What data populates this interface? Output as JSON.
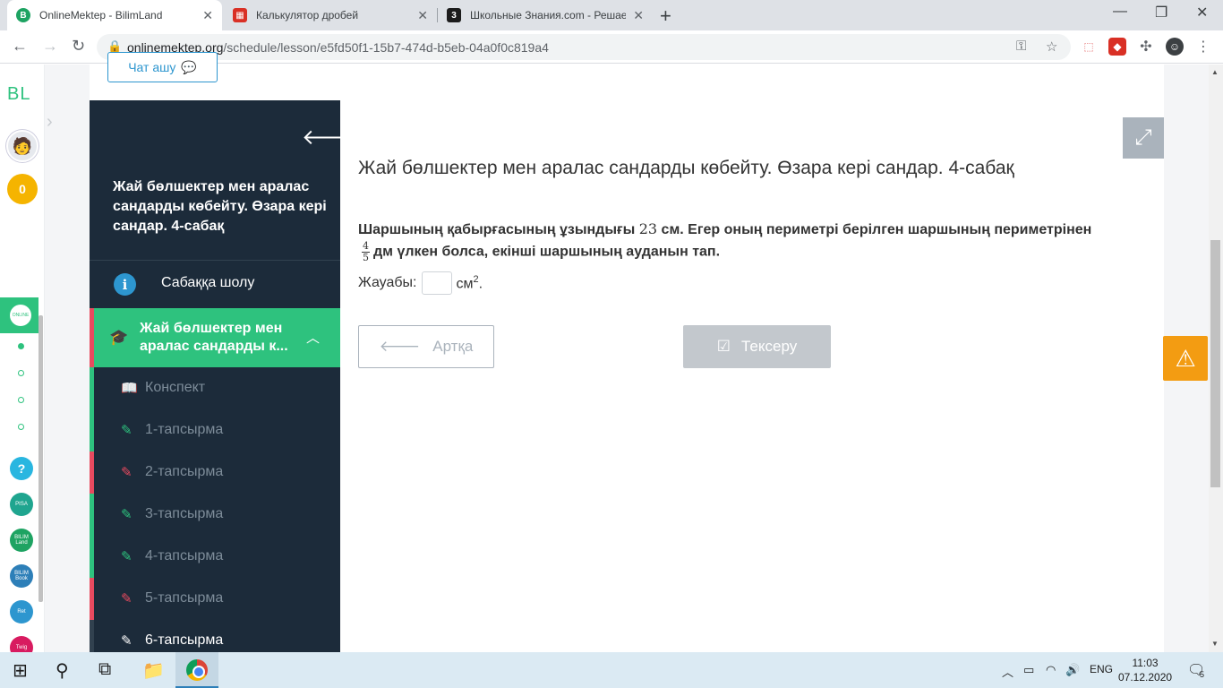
{
  "browser": {
    "tabs": [
      {
        "title": "OnlineMektep - BilimLand",
        "active": true,
        "favicon_color": "#1ea362",
        "favicon_glyph": "B"
      },
      {
        "title": "Калькулятор дробей",
        "active": false,
        "favicon_color": "#d93025",
        "favicon_glyph": "▦"
      },
      {
        "title": "Школьные Знания.com - Решае",
        "active": false,
        "favicon_color": "#1c1c1c",
        "favicon_glyph": "3"
      }
    ],
    "url_host": "onlinemektep.org",
    "url_path": "/schedule/lesson/e5fd50f1-15b7-474d-b5eb-04a0f0c819a4"
  },
  "rail": {
    "logo": "BL",
    "score": "0",
    "apps": [
      {
        "label": "?",
        "color": "#29b6e0"
      },
      {
        "label": "PISA",
        "color": "#1fa58f"
      },
      {
        "label": "BILIM Land",
        "color": "#1ea362"
      },
      {
        "label": "BILIM Book",
        "color": "#2d7fb8"
      },
      {
        "label": "Ret",
        "color": "#2d96cf"
      },
      {
        "label": "Twig",
        "color": "#d81b60"
      }
    ]
  },
  "chat_button": {
    "label": "Чат ашу"
  },
  "sidebar": {
    "title": "Жай бөлшектер мен аралас сандарды көбейту. Өзара кері сандар. 4-сабақ",
    "overview": "Сабаққа шолу",
    "section": "Жай бөлшектер мен аралас сандарды к...",
    "items": [
      {
        "label": "Конспект",
        "status": "green",
        "icon": "book-icon"
      },
      {
        "label": "1-тапсырма",
        "status": "green",
        "icon": "edit-icon"
      },
      {
        "label": "2-тапсырма",
        "status": "red",
        "icon": "edit-icon"
      },
      {
        "label": "3-тапсырма",
        "status": "green",
        "icon": "edit-icon"
      },
      {
        "label": "4-тапсырма",
        "status": "green",
        "icon": "edit-icon"
      },
      {
        "label": "5-тапсырма",
        "status": "red",
        "icon": "edit-icon"
      },
      {
        "label": "6-тапсырма",
        "status": "current",
        "icon": "edit-icon"
      }
    ]
  },
  "lesson": {
    "title": "Жай бөлшектер мен аралас сандарды көбейту. Өзара кері сандар. 4-сабақ",
    "question_part1": "Шаршының қабырғасының ұзындығы ",
    "question_num": "23",
    "question_part2": " см. Егер оның периметрі берілген шаршының периметрінен",
    "fraction_num": "4",
    "fraction_den": "5",
    "question_part3": "дм үлкен болса, екінші шаршының ауданын тап.",
    "answer_label": "Жауабы:",
    "answer_unit": "см",
    "answer_exp": "2",
    "answer_end": ".",
    "back_button": "Артқа",
    "check_button": "Тексеру"
  },
  "taskbar": {
    "lang": "ENG",
    "time": "11:03",
    "date": "07.12.2020",
    "notifications": "5"
  },
  "colors": {
    "sidebar_bg": "#1c2b3a",
    "accent_green": "#2ec27e",
    "status_red": "#e84a5f",
    "link_blue": "#2d96cf",
    "warning_orange": "#f39c12"
  }
}
